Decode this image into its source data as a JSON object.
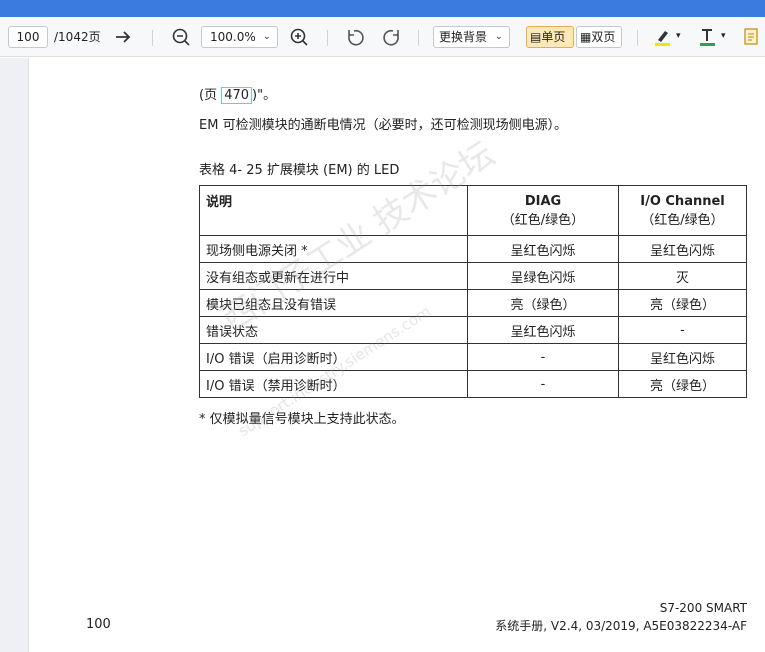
{
  "toolbar": {
    "page_number": "100",
    "page_total": "/1042页",
    "zoom_value": "100.0%",
    "background_label": "更换背景",
    "single_page_label": "单页",
    "double_page_label": "双页"
  },
  "document": {
    "top_line_prefix": "(页",
    "top_line_page_ref": "470",
    "top_line_suffix": ")\"。",
    "em_sentence": "EM 可检测模块的通断电情况（必要时，还可检测现场侧电源）。",
    "table_caption": "表格 4- 25    扩展模块 (EM) 的 LED",
    "table": {
      "header_desc": "说明",
      "header_diag": "DIAG",
      "header_diag_sub": "（红色/绿色）",
      "header_io": "I/O Channel",
      "header_io_sub": "（红色/绿色）",
      "rows": [
        {
          "desc": "现场侧电源关闭 *",
          "diag": "呈红色闪烁",
          "io": "呈红色闪烁"
        },
        {
          "desc": "没有组态或更新在进行中",
          "diag": "呈绿色闪烁",
          "io": "灭"
        },
        {
          "desc": "模块已组态且没有错误",
          "diag": "亮（绿色）",
          "io": "亮（绿色）"
        },
        {
          "desc": "错误状态",
          "diag": "呈红色闪烁",
          "io": "-"
        },
        {
          "desc": "I/O 错误（启用诊断时）",
          "diag": "-",
          "io": "呈红色闪烁"
        },
        {
          "desc": "I/O 错误（禁用诊断时）",
          "diag": "-",
          "io": "亮（绿色）"
        }
      ]
    },
    "footnote": "* 仅模拟量信号模块上支持此状态。",
    "footer_page": "100",
    "footer_product": "S7-200 SMART",
    "footer_manual": "系统手册, V2.4, 03/2019, A5E03822234-AF"
  },
  "watermark": {
    "line1": "西门子工业  技术论坛",
    "line2": "support.industry.siemens.com"
  },
  "colors": {
    "title_bar": "#3a7be0",
    "active_button_bg": "#fde9b8",
    "highlight_yellow": "#f5e400",
    "text_color_green": "#2aa05a"
  }
}
